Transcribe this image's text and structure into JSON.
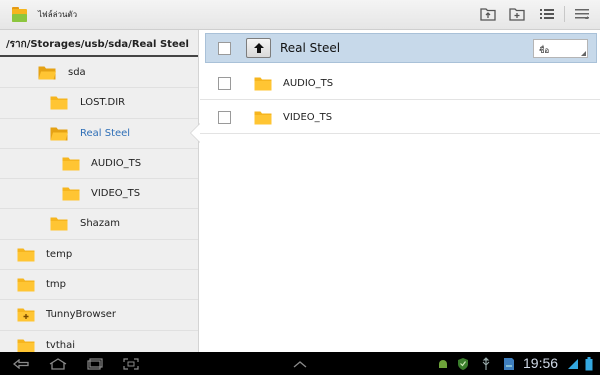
{
  "app": {
    "title": "ไฟล์ล่วนตัว",
    "icon": "folder-app-icon"
  },
  "actionbar": {
    "buttons": [
      {
        "name": "folder-bookmark-button",
        "icon": "folder-up-icon"
      },
      {
        "name": "new-folder-button",
        "icon": "folder-plus-icon"
      },
      {
        "name": "list-view-button",
        "icon": "list-icon"
      },
      {
        "name": "overflow-menu-button",
        "icon": "menu-icon"
      }
    ]
  },
  "left_pane": {
    "path": "/ราก/Storages/usb/sda/Real Steel",
    "tree": [
      {
        "label": "sda",
        "indent": 1,
        "open": true,
        "selected": false
      },
      {
        "label": "LOST.DIR",
        "indent": 2,
        "open": false,
        "selected": false
      },
      {
        "label": "Real Steel",
        "indent": 2,
        "open": true,
        "selected": true
      },
      {
        "label": "AUDIO_TS",
        "indent": 3,
        "open": false,
        "selected": false
      },
      {
        "label": "VIDEO_TS",
        "indent": 3,
        "open": false,
        "selected": false
      },
      {
        "label": "Shazam",
        "indent": 2,
        "open": false,
        "selected": false
      },
      {
        "label": "temp",
        "indent": 0,
        "open": false,
        "selected": false
      },
      {
        "label": "tmp",
        "indent": 0,
        "open": false,
        "selected": false
      },
      {
        "label": "TunnyBrowser",
        "indent": 0,
        "open": false,
        "selected": false,
        "badge": "+"
      },
      {
        "label": "tvthai",
        "indent": 0,
        "open": false,
        "selected": false
      }
    ]
  },
  "right_pane": {
    "current_folder": "Real Steel",
    "sort_label": "ชื่อ",
    "files": [
      {
        "name": "AUDIO_TS"
      },
      {
        "name": "VIDEO_TS"
      }
    ]
  },
  "system_bar": {
    "time": "19:56",
    "left_icons": [
      "back-icon",
      "home-icon",
      "recent-apps-icon",
      "screenshot-icon"
    ],
    "right_icons": [
      "android-debug-icon",
      "shield-icon",
      "usb-icon",
      "sd-card-icon",
      "wifi-icon",
      "battery-icon"
    ]
  },
  "colors": {
    "header_row": "#c7d9ea",
    "selected_text": "#2f6fb7",
    "folder": "#f6b51e"
  }
}
